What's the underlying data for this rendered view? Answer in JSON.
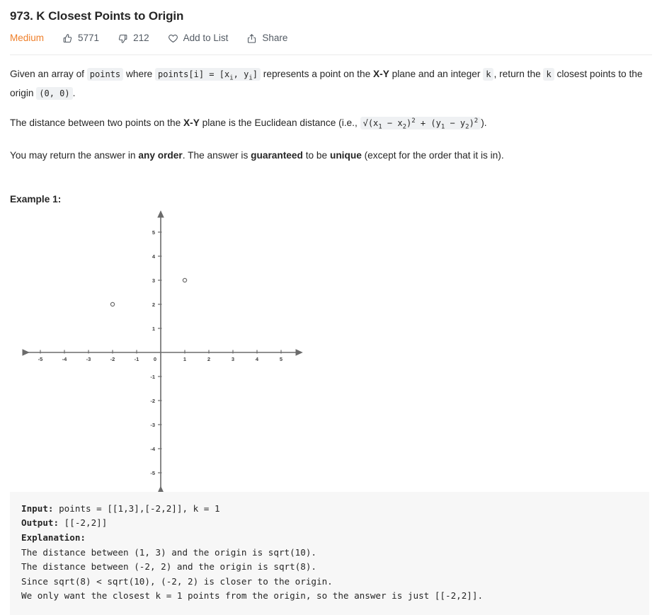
{
  "header": {
    "title": "973. K Closest Points to Origin",
    "difficulty": "Medium",
    "likes": "5771",
    "dislikes": "212",
    "add_to_list": "Add to List",
    "share": "Share",
    "difficulty_color": "#ef7f2a"
  },
  "description": {
    "p1_a": "Given an array of ",
    "p1_code1": "points",
    "p1_b": " where ",
    "p1_code2": "points[i] = [x",
    "p1_code2_sub1": "i",
    "p1_code2_mid": ", y",
    "p1_code2_sub2": "i",
    "p1_code2_end": "]",
    "p1_c": " represents a point on the ",
    "p1_bold1": "X-Y",
    "p1_d": " plane and an integer ",
    "p1_code3": "k",
    "p1_e": ", return the ",
    "p1_code4": "k",
    "p1_f": " closest points to the origin ",
    "p1_code5": "(0, 0)",
    "p1_g": ".",
    "p2_a": "The distance between two points on the ",
    "p2_bold": "X-Y",
    "p2_b": " plane is the Euclidean distance (i.e., ",
    "p2_formula_1": "√(x",
    "p2_formula_sub1": "1",
    "p2_formula_2": " − x",
    "p2_formula_sub2": "2",
    "p2_formula_3": ")",
    "p2_formula_sup1": "2",
    "p2_formula_4": " + (y",
    "p2_formula_sub3": "1",
    "p2_formula_5": " − y",
    "p2_formula_sub4": "2",
    "p2_formula_6": ")",
    "p2_formula_sup2": "2",
    "p2_c": ").",
    "p3_a": "You may return the answer in ",
    "p3_bold1": "any order",
    "p3_b": ". The answer is ",
    "p3_bold2": "guaranteed",
    "p3_c": " to be ",
    "p3_bold3": "unique",
    "p3_d": " (except for the order that it is in)."
  },
  "example": {
    "label": "Example 1:",
    "input_label": "Input:",
    "input_value": " points = [[1,3],[-2,2]], k = 1",
    "output_label": "Output:",
    "output_value": " [[-2,2]]",
    "explanation_label": "Explanation:",
    "explanation_lines": [
      "The distance between (1, 3) and the origin is sqrt(10).",
      "The distance between (-2, 2) and the origin is sqrt(8).",
      "Since sqrt(8) < sqrt(10), (-2, 2) is closer to the origin.",
      "We only want the closest k = 1 points from the origin, so the answer is just [[-2,2]]."
    ]
  },
  "chart_data": {
    "type": "scatter",
    "title": "",
    "xlabel": "",
    "ylabel": "",
    "xlim": [
      -5.6,
      5.6
    ],
    "ylim": [
      -5.6,
      5.6
    ],
    "grid": false,
    "legend": "none",
    "x_ticks": [
      "-5",
      "-4",
      "-3",
      "-2",
      "-1",
      "0",
      "1",
      "2",
      "3",
      "4",
      "5"
    ],
    "y_ticks": [
      "5",
      "4",
      "3",
      "2",
      "1",
      "-1",
      "-2",
      "-3",
      "-4",
      "-5"
    ],
    "axis_color": "#6b6b6b",
    "marker_color": "#6b6b6b",
    "points": [
      {
        "x": 1,
        "y": 3,
        "label": "(1, 3)"
      },
      {
        "x": -2,
        "y": 2,
        "label": "(-2, 2)"
      }
    ]
  }
}
